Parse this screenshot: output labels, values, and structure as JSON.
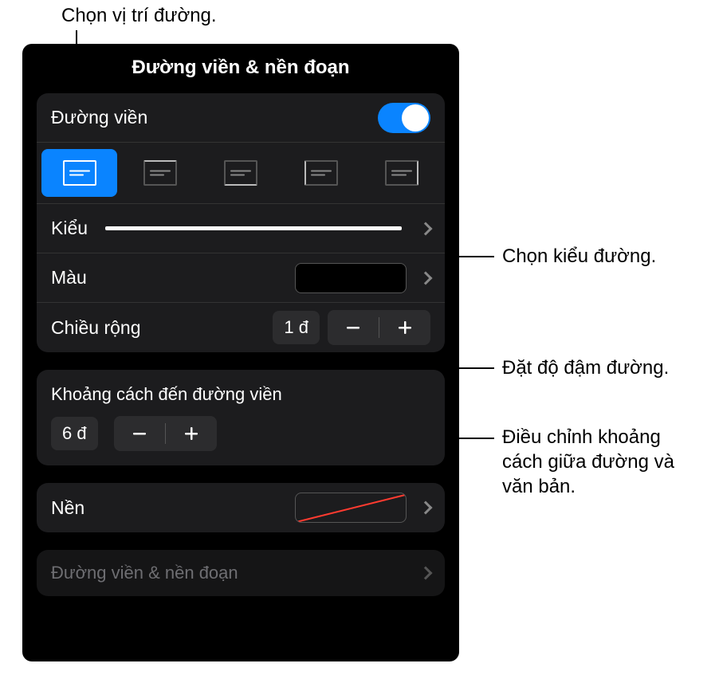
{
  "callouts": {
    "position": "Chọn vị trí đường.",
    "style": "Chọn kiểu đường.",
    "weight": "Đặt độ đậm đường.",
    "offset": "Điều chỉnh khoảng cách giữa đường và văn bản."
  },
  "panel": {
    "title": "Đường viền & nền đoạn",
    "border_section": {
      "label": "Đường viền",
      "toggle_on": true,
      "positions": [
        "all",
        "top",
        "bottom",
        "left",
        "right"
      ],
      "style_label": "Kiểu",
      "color_label": "Màu",
      "color_value": "#000000",
      "width_label": "Chiều rộng",
      "width_value": "1 đ"
    },
    "offset_section": {
      "label": "Khoảng cách đến đường viền",
      "value": "6 đ"
    },
    "background_section": {
      "label": "Nền"
    },
    "faded_label": "Đường viền & nền đoạn"
  }
}
